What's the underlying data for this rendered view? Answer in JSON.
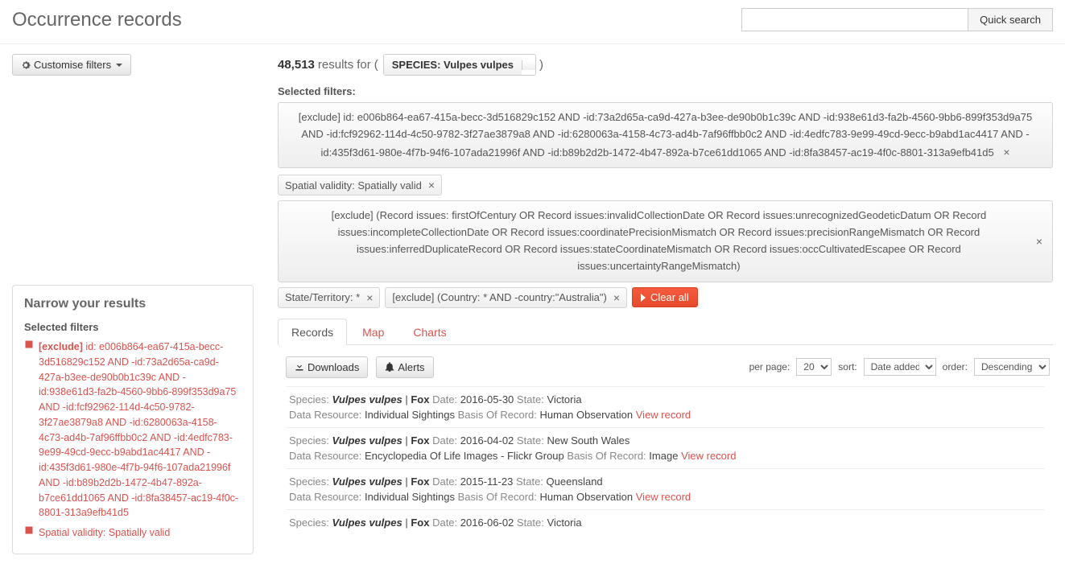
{
  "page": {
    "title": "Occurrence records",
    "quick_search_label": "Quick search"
  },
  "customise_btn": "Customise filters",
  "results": {
    "count": "48,513",
    "for_text": "results for",
    "species_label": "SPECIES: Vulpes vulpes"
  },
  "selected_filters_label": "Selected filters",
  "filter_exclude_ids": "[exclude] id: e006b864-ea67-415a-becc-3d516829c152 AND -id:73a2d65a-ca9d-427a-b3ee-de90b0b1c39c AND -id:938e61d3-fa2b-4560-9bb6-899f353d9a75 AND -id:fcf92962-114d-4c50-9782-3f27ae3879a8 AND -id:6280063a-4158-4c73-ad4b-7af96ffbb0c2 AND -id:4edfc783-9e99-49cd-9ecc-b9abd1ac4417 AND -id:435f3d61-980e-4f7b-94f6-107ada21996f AND -id:b89b2d2b-1472-4b47-892a-b7ce61dd1065 AND -id:8fa38457-ac19-4f0c-8801-313a9efb41d5",
  "filter_spatial": "Spatial validity: Spatially valid",
  "filter_exclude_issues": "[exclude] (Record issues: firstOfCentury OR Record issues:invalidCollectionDate OR Record issues:unrecognizedGeodeticDatum OR Record issues:incompleteCollectionDate OR Record issues:coordinatePrecisionMismatch OR Record issues:precisionRangeMismatch OR Record issues:inferredDuplicateRecord OR Record issues:stateCoordinateMismatch OR Record issues:occCultivatedEscapee OR Record issues:uncertaintyRangeMismatch)",
  "filter_state": "State/Territory: *",
  "filter_country": "[exclude] (Country: * AND -country:\"Australia\")",
  "clear_all": "Clear all",
  "tabs": {
    "records": "Records",
    "map": "Map",
    "charts": "Charts"
  },
  "toolbar": {
    "downloads": "Downloads",
    "alerts": "Alerts",
    "per_page_label": "per page:",
    "per_page_value": "20",
    "sort_label": "sort:",
    "sort_value": "Date added",
    "order_label": "order:",
    "order_value": "Descending"
  },
  "records": [
    {
      "species": "Vulpes vulpes",
      "common": "Fox",
      "date": "2016-05-30",
      "state": "Victoria",
      "resource": "Individual Sightings",
      "basis": "Human Observation",
      "view": "View record"
    },
    {
      "species": "Vulpes vulpes",
      "common": "Fox",
      "date": "2016-04-02",
      "state": "New South Wales",
      "resource": "Encyclopedia Of Life Images - Flickr Group",
      "basis": "Image",
      "view": "View record"
    },
    {
      "species": "Vulpes vulpes",
      "common": "Fox",
      "date": "2015-11-23",
      "state": "Queensland",
      "resource": "Individual Sightings",
      "basis": "Human Observation",
      "view": "View record"
    },
    {
      "species": "Vulpes vulpes",
      "common": "Fox",
      "date": "2016-06-02",
      "state": "Victoria",
      "resource": "",
      "basis": "",
      "view": ""
    }
  ],
  "sidebar": {
    "narrow_title": "Narrow your results",
    "selected_label": "Selected filters",
    "filter1_prefix": "[exclude]",
    "filter1_rest": " id: e006b864-ea67-415a-becc-3d516829c152 AND -id:73a2d65a-ca9d-427a-b3ee-de90b0b1c39c AND -id:938e61d3-fa2b-4560-9bb6-899f353d9a75 AND -id:fcf92962-114d-4c50-9782-3f27ae3879a8 AND -id:6280063a-4158-4c73-ad4b-7af96ffbb0c2 AND -id:4edfc783-9e99-49cd-9ecc-b9abd1ac4417 AND -id:435f3d61-980e-4f7b-94f6-107ada21996f AND -id:b89b2d2b-1472-4b47-892a-b7ce61dd1065 AND -id:8fa38457-ac19-4f0c-8801-313a9efb41d5",
    "filter2": "Spatial validity: Spatially valid"
  },
  "labels": {
    "species": "Species:",
    "date": "Date:",
    "state": "State:",
    "resource": "Data Resource:",
    "basis": "Basis Of Record:"
  }
}
